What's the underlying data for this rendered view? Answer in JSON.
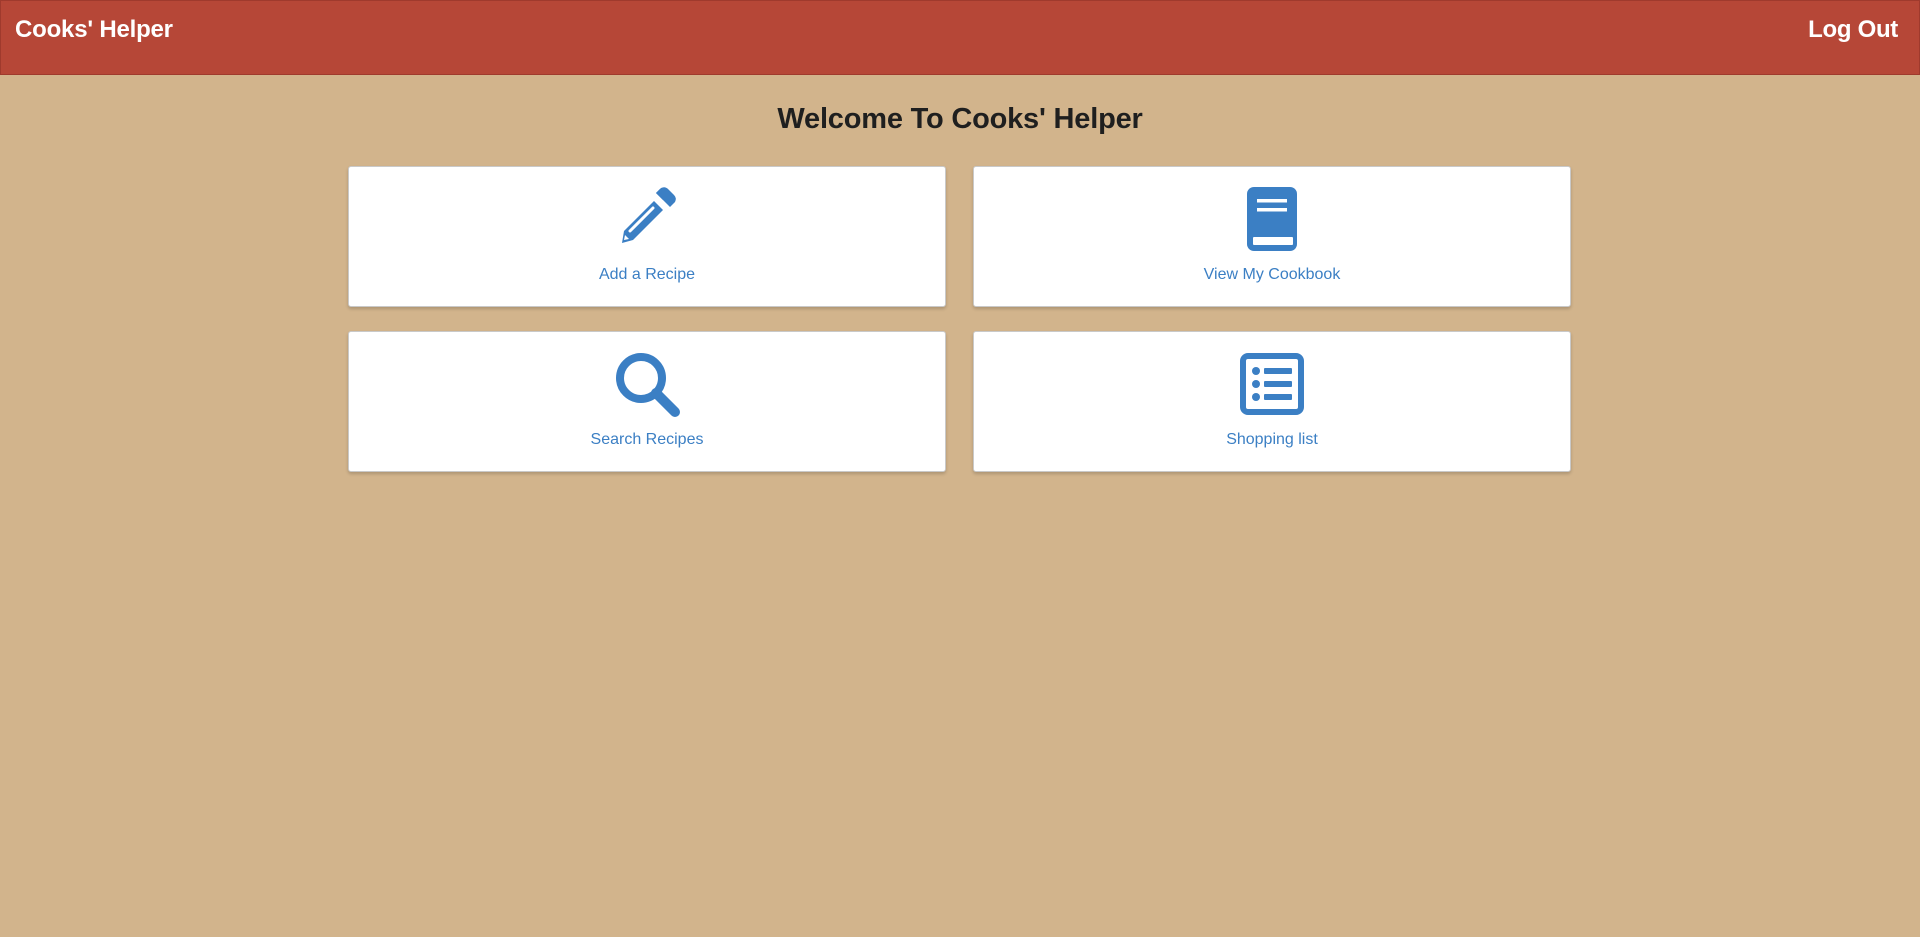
{
  "navbar": {
    "brand": "Cooks' Helper",
    "logout_label": "Log Out",
    "background_color": "#b64737"
  },
  "main": {
    "heading": "Welcome To Cooks' Helper",
    "tiles": [
      {
        "label": "Add a Recipe",
        "icon": "pencil-icon"
      },
      {
        "label": "View My Cookbook",
        "icon": "book-icon"
      },
      {
        "label": "Search Recipes",
        "icon": "search-icon"
      },
      {
        "label": "Shopping list",
        "icon": "list-icon"
      }
    ]
  },
  "colors": {
    "page_background": "#d2b48c",
    "accent": "#3b7fc4",
    "tile_background": "#ffffff"
  }
}
